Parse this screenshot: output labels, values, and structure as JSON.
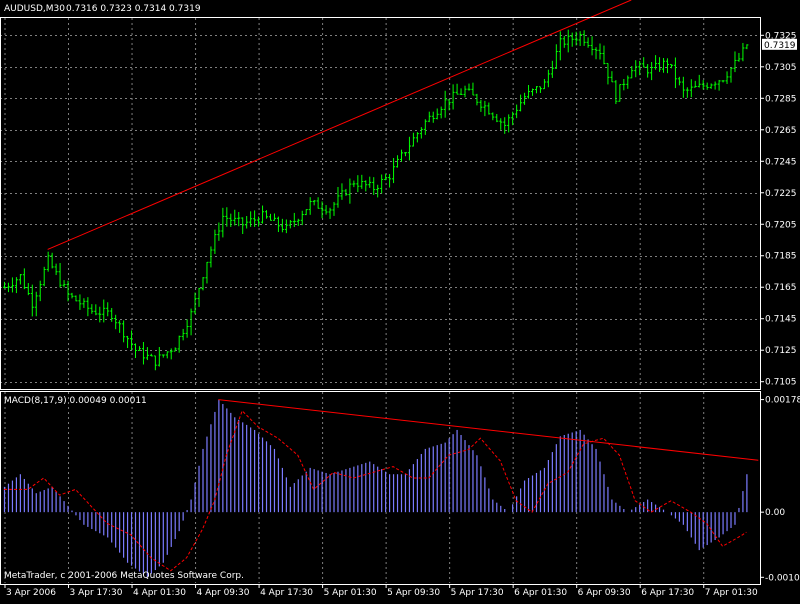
{
  "window": {
    "symbol_label": "AUDUSD,M30",
    "ohlc_label": "0.7316 0.7323 0.7314 0.7319",
    "copyright": "MetaTrader, c 2001-2006 MetaQuotes Software Corp."
  },
  "colors": {
    "background": "#000000",
    "grid": "#7f7f7f",
    "candle": "#00ff00",
    "trendline": "#ff0000",
    "histogram": "#7b7bff",
    "signal": "#ff0000",
    "text": "#ffffff",
    "current_price_box": "#ffffff"
  },
  "chart_data": [
    {
      "type": "candlestick",
      "title": "AUDUSD,M30",
      "series_label": "0.7316 0.7323 0.7314 0.7319",
      "ylim": [
        0.7101,
        0.7336
      ],
      "ytick_labels": [
        "0.7325",
        "0.7305",
        "0.7285",
        "0.7265",
        "0.7245",
        "0.7225",
        "0.7205",
        "0.7185",
        "0.7165",
        "0.7145",
        "0.7125",
        "0.7105"
      ],
      "ytick_values": [
        0.7325,
        0.7305,
        0.7285,
        0.7265,
        0.7245,
        0.7225,
        0.7205,
        0.7185,
        0.7165,
        0.7145,
        0.7125,
        0.7105
      ],
      "xtick_labels": [
        "3 Apr 2006",
        "3 Apr 17:30",
        "4 Apr 01:30",
        "4 Apr 09:30",
        "4 Apr 17:30",
        "5 Apr 01:30",
        "5 Apr 09:30",
        "5 Apr 17:30",
        "6 Apr 01:30",
        "6 Apr 09:30",
        "6 Apr 17:30",
        "7 Apr 01:30"
      ],
      "bar_count": 188,
      "current_price": "0.7319",
      "close_path": [
        {
          "bar": 0,
          "price": 0.7165
        },
        {
          "bar": 4,
          "price": 0.7172
        },
        {
          "bar": 7,
          "price": 0.7155
        },
        {
          "bar": 11,
          "price": 0.7182
        },
        {
          "bar": 16,
          "price": 0.716
        },
        {
          "bar": 22,
          "price": 0.715
        },
        {
          "bar": 27,
          "price": 0.7148
        },
        {
          "bar": 33,
          "price": 0.7125
        },
        {
          "bar": 38,
          "price": 0.7118
        },
        {
          "bar": 43,
          "price": 0.7128
        },
        {
          "bar": 47,
          "price": 0.7148
        },
        {
          "bar": 51,
          "price": 0.7182
        },
        {
          "bar": 55,
          "price": 0.721
        },
        {
          "bar": 60,
          "price": 0.7205
        },
        {
          "bar": 65,
          "price": 0.721
        },
        {
          "bar": 71,
          "price": 0.7202
        },
        {
          "bar": 77,
          "price": 0.7218
        },
        {
          "bar": 82,
          "price": 0.7215
        },
        {
          "bar": 88,
          "price": 0.7232
        },
        {
          "bar": 93,
          "price": 0.7228
        },
        {
          "bar": 97,
          "price": 0.7236
        },
        {
          "bar": 101,
          "price": 0.7252
        },
        {
          "bar": 106,
          "price": 0.727
        },
        {
          "bar": 111,
          "price": 0.7283
        },
        {
          "bar": 116,
          "price": 0.729
        },
        {
          "bar": 121,
          "price": 0.728
        },
        {
          "bar": 126,
          "price": 0.7268
        },
        {
          "bar": 131,
          "price": 0.7286
        },
        {
          "bar": 136,
          "price": 0.7294
        },
        {
          "bar": 140,
          "price": 0.732
        },
        {
          "bar": 145,
          "price": 0.7325
        },
        {
          "bar": 150,
          "price": 0.7315
        },
        {
          "bar": 154,
          "price": 0.7286
        },
        {
          "bar": 158,
          "price": 0.7305
        },
        {
          "bar": 163,
          "price": 0.7303
        },
        {
          "bar": 167,
          "price": 0.7308
        },
        {
          "bar": 171,
          "price": 0.7289
        },
        {
          "bar": 176,
          "price": 0.7293
        },
        {
          "bar": 181,
          "price": 0.7298
        },
        {
          "bar": 185,
          "price": 0.731
        },
        {
          "bar": 187,
          "price": 0.7319
        }
      ],
      "trendline": {
        "from": {
          "bar": 11,
          "price": 0.7189
        },
        "to": {
          "bar": 158,
          "price": 0.7348
        }
      },
      "xlabel": "",
      "ylabel": ""
    },
    {
      "type": "bar",
      "title": "MACD(8,17,9) 0.00049 0.00011",
      "ylim": [
        -0.00112,
        0.0019
      ],
      "ytick_labels": [
        "0.00178",
        "0.00",
        "-0.00103"
      ],
      "ytick_values": [
        0.00178,
        0.0,
        -0.00103
      ],
      "macd_path": [
        {
          "bar": 0,
          "value": 0.0004
        },
        {
          "bar": 4,
          "value": 0.0006
        },
        {
          "bar": 8,
          "value": 0.0003
        },
        {
          "bar": 12,
          "value": 0.0004
        },
        {
          "bar": 16,
          "value": 0.0001
        },
        {
          "bar": 20,
          "value": -0.0002
        },
        {
          "bar": 26,
          "value": -0.0004
        },
        {
          "bar": 31,
          "value": -0.0008
        },
        {
          "bar": 36,
          "value": -0.00103
        },
        {
          "bar": 40,
          "value": -0.0008
        },
        {
          "bar": 44,
          "value": -0.0003
        },
        {
          "bar": 47,
          "value": 0.0002
        },
        {
          "bar": 50,
          "value": 0.001
        },
        {
          "bar": 54,
          "value": 0.00178
        },
        {
          "bar": 58,
          "value": 0.0015
        },
        {
          "bar": 63,
          "value": 0.0013
        },
        {
          "bar": 68,
          "value": 0.001
        },
        {
          "bar": 72,
          "value": 0.0004
        },
        {
          "bar": 77,
          "value": 0.0007
        },
        {
          "bar": 82,
          "value": 0.0006
        },
        {
          "bar": 87,
          "value": 0.0007
        },
        {
          "bar": 92,
          "value": 0.0008
        },
        {
          "bar": 97,
          "value": 0.0006
        },
        {
          "bar": 101,
          "value": 0.0006
        },
        {
          "bar": 106,
          "value": 0.001
        },
        {
          "bar": 111,
          "value": 0.0011
        },
        {
          "bar": 114,
          "value": 0.0013
        },
        {
          "bar": 119,
          "value": 0.0009
        },
        {
          "bar": 123,
          "value": 0.0002
        },
        {
          "bar": 127,
          "value": 0.0
        },
        {
          "bar": 131,
          "value": 0.0005
        },
        {
          "bar": 136,
          "value": 0.0007
        },
        {
          "bar": 140,
          "value": 0.0012
        },
        {
          "bar": 145,
          "value": 0.0013
        },
        {
          "bar": 149,
          "value": 0.001
        },
        {
          "bar": 153,
          "value": 0.0002
        },
        {
          "bar": 157,
          "value": 0.0
        },
        {
          "bar": 162,
          "value": 0.0002
        },
        {
          "bar": 167,
          "value": 0.0
        },
        {
          "bar": 171,
          "value": -0.0002
        },
        {
          "bar": 175,
          "value": -0.0006
        },
        {
          "bar": 180,
          "value": -0.0004
        },
        {
          "bar": 184,
          "value": -0.0002
        },
        {
          "bar": 187,
          "value": 0.0006
        }
      ],
      "signal_lag_bars": 6,
      "trendline": {
        "from": {
          "bar": 54,
          "value": 0.00178
        },
        "to": {
          "bar": 190,
          "value": 0.00082
        }
      },
      "xlabel": "",
      "ylabel": ""
    }
  ]
}
